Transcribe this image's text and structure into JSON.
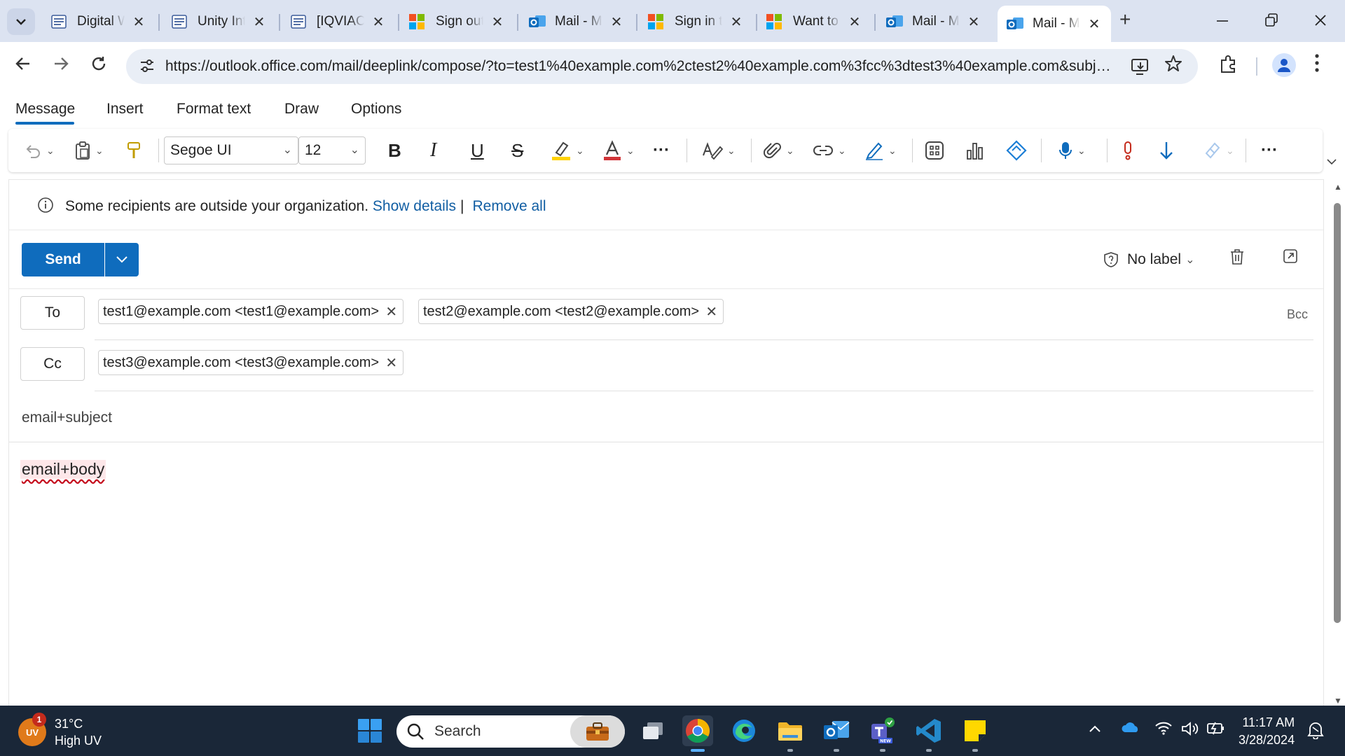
{
  "browser": {
    "tabs": [
      {
        "title": "Digital W",
        "favicon": "doc-icon"
      },
      {
        "title": "Unity Int",
        "favicon": "doc-icon"
      },
      {
        "title": "[IQVIAC",
        "favicon": "doc-icon"
      },
      {
        "title": "Sign out",
        "favicon": "microsoft-icon"
      },
      {
        "title": "Mail - M",
        "favicon": "outlook-icon"
      },
      {
        "title": "Sign in t",
        "favicon": "microsoft-icon"
      },
      {
        "title": "Want to",
        "favicon": "microsoft-icon"
      },
      {
        "title": "Mail - M",
        "favicon": "outlook-icon"
      },
      {
        "title": "Mail - M",
        "favicon": "outlook-icon"
      }
    ],
    "active_tab_index": 8,
    "url": "https://outlook.office.com/mail/deeplink/compose/?to=test1%40example.com%2ctest2%40example.com%3fcc%3dtest3%40example.com&subject=email+subject&body=email+body",
    "new_tab_label": "+"
  },
  "ribbon": {
    "tabs": [
      "Message",
      "Insert",
      "Format text",
      "Draw",
      "Options"
    ],
    "active": "Message",
    "font_name": "Segoe UI",
    "font_size": "12",
    "bold": "B",
    "italic": "I",
    "underline": "U",
    "strike": "S",
    "more": "···",
    "highlight_color": "#ffd200",
    "font_color": "#d13438"
  },
  "infobar": {
    "message": "Some recipients are outside your organization.",
    "show_details": "Show details",
    "pipe": "|",
    "remove_all": "Remove all"
  },
  "compose": {
    "send_label": "Send",
    "sensitivity_label": "No label",
    "to_label": "To",
    "cc_label": "Cc",
    "bcc_label": "Bcc",
    "to_recipients": [
      "test1@example.com <test1@example.com>",
      "test2@example.com <test2@example.com>"
    ],
    "cc_recipients": [
      "test3@example.com <test3@example.com>"
    ],
    "subject": "email+subject",
    "body": "email+body",
    "accent_color": "#0f6cbd"
  },
  "taskbar": {
    "weather_badge": "1",
    "weather_abbrev": "UV",
    "temperature": "31°C",
    "condition": "High UV",
    "search_placeholder": "Search",
    "time": "11:17 AM",
    "date": "3/28/2024"
  }
}
